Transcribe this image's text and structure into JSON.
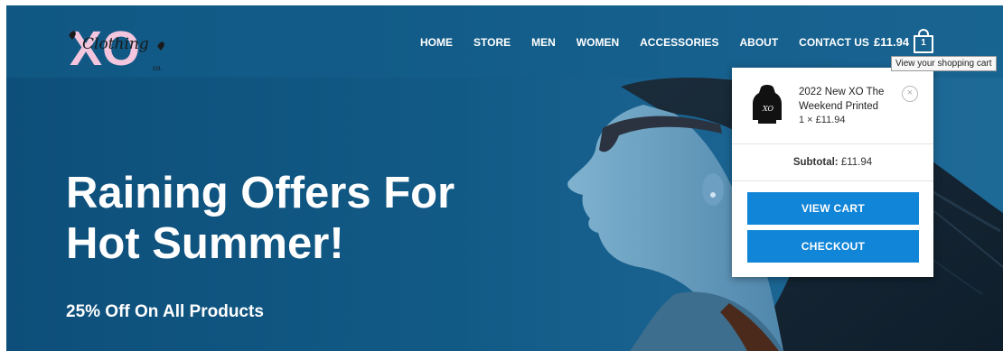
{
  "logo": {
    "letters": "XO",
    "script": "Clothing",
    "suffix": "co."
  },
  "nav": [
    "HOME",
    "STORE",
    "MEN",
    "WOMEN",
    "ACCESSORIES",
    "ABOUT",
    "CONTACT US"
  ],
  "cart": {
    "total": "£11.94",
    "count": "1",
    "tooltip": "View your shopping cart"
  },
  "hero": {
    "title_line1": "Raining Offers For",
    "title_line2": "Hot Summer!",
    "subtitle": "25% Off On All Products"
  },
  "minicart": {
    "item_name": "2022 New XO The Weekend Printed",
    "item_qty": "1 × £11.94",
    "remove": "×",
    "subtotal_label": "Subtotal:",
    "subtotal_value": "£11.94",
    "view_cart": "VIEW CART",
    "checkout": "CHECKOUT"
  },
  "colors": {
    "hero_bg": "#125a86",
    "button": "#1185d8",
    "logo_pink": "#f3c6de"
  }
}
